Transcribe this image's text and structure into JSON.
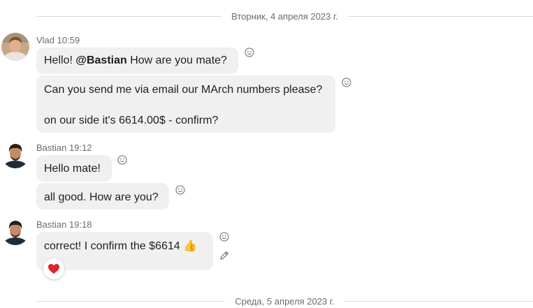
{
  "dividers": [
    {
      "date": "Вторник, 4 апреля 2023 г."
    },
    {
      "date": "Среда, 5 апреля 2023 г."
    }
  ],
  "groups": [
    {
      "sender": "Vlad",
      "time": "10:59",
      "avatar": "vlad-avatar-photo",
      "messages": [
        {
          "before": "Hello! ",
          "mention": "@Bastian",
          "after": " How are you mate?"
        },
        {
          "lines": [
            "Can you send me via email our MArch numbers please?",
            "on our side it's 6614.00$ - confirm?"
          ]
        }
      ]
    },
    {
      "sender": "Bastian",
      "time": "19:12",
      "avatar": "bastian-avatar-photo",
      "messages": [
        {
          "text": "Hello mate!"
        },
        {
          "text": "all good. How are you?"
        }
      ]
    },
    {
      "sender": "Bastian",
      "time": "19:18",
      "avatar": "bastian-avatar-photo",
      "messages": [
        {
          "text": "correct! I confirm the $6614",
          "emoji": "👍",
          "reaction": "heart"
        }
      ]
    }
  ],
  "icons": {
    "react": "smiley-icon",
    "edit": "pencil-icon",
    "reaction": "heart-icon"
  },
  "colors": {
    "bubble": "#f0f0f0",
    "heart": "#e0242b",
    "text_secondary": "#6b6b6b"
  }
}
